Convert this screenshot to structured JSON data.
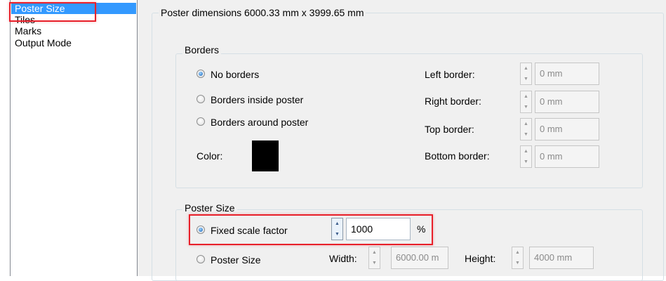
{
  "nav": {
    "items": [
      {
        "label": "Poster Size",
        "selected": true
      },
      {
        "label": "Tiles"
      },
      {
        "label": "Marks"
      },
      {
        "label": "Output Mode"
      }
    ]
  },
  "main": {
    "group_title": "Poster dimensions 6000.33 mm x 3999.65 mm",
    "borders": {
      "title": "Borders",
      "options": [
        "No borders",
        "Borders inside poster",
        "Borders around poster"
      ],
      "selected": "No borders",
      "color_label": "Color:",
      "color_value": "#000000",
      "fields": [
        {
          "label": "Left border:",
          "value": "0 mm"
        },
        {
          "label": "Right border:",
          "value": "0 mm"
        },
        {
          "label": "Top border:",
          "value": "0 mm"
        },
        {
          "label": "Bottom border:",
          "value": "0 mm"
        }
      ]
    },
    "poster_size": {
      "title": "Poster Size",
      "fixed_scale_label": "Fixed scale factor",
      "scale_value": "1000",
      "scale_unit": "%",
      "poster_size_label": "Poster Size",
      "width_label": "Width:",
      "width_value": "6000.00 m",
      "height_label": "Height:",
      "height_value": "4000 mm"
    }
  },
  "colors": {
    "selection": "#3399ff",
    "highlight": "#e8202a",
    "panel_background": "#f0f0f0"
  }
}
